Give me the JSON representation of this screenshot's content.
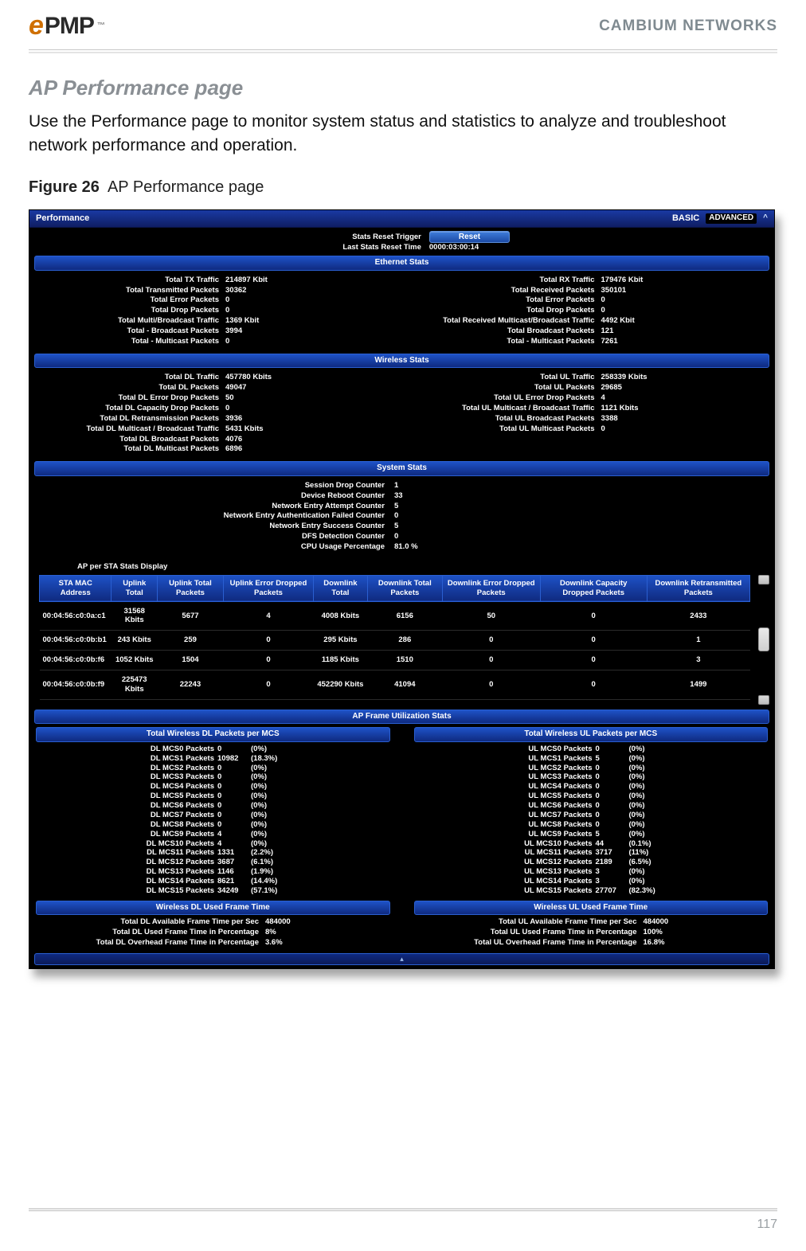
{
  "doc": {
    "logo_text_pmp": "PMP",
    "brand": "CAMBIUM NETWORKS",
    "section_title": "AP Performance page",
    "lead": "Use the Performance page to monitor system status and statistics to analyze and troubleshoot network performance and operation.",
    "figure_label_bold": "Figure 26",
    "figure_label_rest": "AP Performance page",
    "page_number": "117"
  },
  "ui": {
    "title": "Performance",
    "basic": "BASIC",
    "advanced": "ADVANCED",
    "chevron": "^",
    "stats_reset_trigger_label": "Stats Reset Trigger",
    "reset_button": "Reset",
    "last_reset_label": "Last Stats Reset Time",
    "last_reset_value": "0000:03:00:14",
    "ethernet_header": "Ethernet Stats",
    "ethernet_left": [
      {
        "k": "Total TX Traffic",
        "v": "214897 Kbit"
      },
      {
        "k": "Total Transmitted Packets",
        "v": "30362"
      },
      {
        "k": "Total Error Packets",
        "v": "0"
      },
      {
        "k": "Total Drop Packets",
        "v": "0"
      },
      {
        "k": "Total Multi/Broadcast Traffic",
        "v": "1369 Kbit"
      },
      {
        "k": "Total - Broadcast Packets",
        "v": "3994"
      },
      {
        "k": "Total - Multicast Packets",
        "v": "0"
      }
    ],
    "ethernet_right": [
      {
        "k": "Total RX Traffic",
        "v": "179476 Kbit"
      },
      {
        "k": "Total Received Packets",
        "v": "350101"
      },
      {
        "k": "Total Error Packets",
        "v": "0"
      },
      {
        "k": "Total Drop Packets",
        "v": "0"
      },
      {
        "k": "Total Received Multicast/Broadcast Traffic",
        "v": "4492 Kbit"
      },
      {
        "k": "Total Broadcast Packets",
        "v": "121"
      },
      {
        "k": "Total - Multicast Packets",
        "v": "7261"
      }
    ],
    "wireless_header": "Wireless Stats",
    "wireless_left": [
      {
        "k": "Total DL Traffic",
        "v": "457780 Kbits"
      },
      {
        "k": "Total DL Packets",
        "v": "49047"
      },
      {
        "k": "Total DL Error Drop Packets",
        "v": "50"
      },
      {
        "k": "Total DL Capacity Drop Packets",
        "v": "0"
      },
      {
        "k": "Total DL Retransmission Packets",
        "v": "3936"
      },
      {
        "k": "Total DL Multicast / Broadcast Traffic",
        "v": "5431 Kbits"
      },
      {
        "k": "Total DL Broadcast Packets",
        "v": "4076"
      },
      {
        "k": "Total DL Multicast Packets",
        "v": "6896"
      }
    ],
    "wireless_right": [
      {
        "k": "Total UL Traffic",
        "v": "258339 Kbits"
      },
      {
        "k": "Total UL Packets",
        "v": "29685"
      },
      {
        "k": "Total UL Error Drop Packets",
        "v": "4"
      },
      {
        "k": "Total UL Multicast / Broadcast Traffic",
        "v": "1121 Kbits"
      },
      {
        "k": "Total UL Broadcast Packets",
        "v": "3388"
      },
      {
        "k": "Total UL Multicast Packets",
        "v": "0"
      }
    ],
    "system_header": "System  Stats",
    "system_stats": [
      {
        "k": "Session Drop Counter",
        "v": "1"
      },
      {
        "k": "Device Reboot Counter",
        "v": "33"
      },
      {
        "k": "Network Entry Attempt Counter",
        "v": "5"
      },
      {
        "k": "Network Entry Authentication Failed Counter",
        "v": "0"
      },
      {
        "k": "Network Entry Success Counter",
        "v": "5"
      },
      {
        "k": "DFS Detection Counter",
        "v": "0"
      },
      {
        "k": "CPU Usage Percentage",
        "v": "81.0 %"
      }
    ],
    "ap_per_sta_label": "AP per STA Stats Display",
    "sta_headers": [
      "STA MAC Address",
      "Uplink Total",
      "Uplink Total Packets",
      "Uplink Error Dropped Packets",
      "Downlink Total",
      "Downlink Total Packets",
      "Downlink Error Dropped Packets",
      "Downlink Capacity Dropped Packets",
      "Downlink Retransmitted Packets"
    ],
    "sta_rows": [
      [
        "00:04:56:c0:0a:c1",
        "31568 Kbits",
        "5677",
        "4",
        "4008 Kbits",
        "6156",
        "50",
        "0",
        "2433"
      ],
      [
        "00:04:56:c0:0b:b1",
        "243 Kbits",
        "259",
        "0",
        "295 Kbits",
        "286",
        "0",
        "0",
        "1"
      ],
      [
        "00:04:56:c0:0b:f6",
        "1052 Kbits",
        "1504",
        "0",
        "1185 Kbits",
        "1510",
        "0",
        "0",
        "3"
      ],
      [
        "00:04:56:c0:0b:f9",
        "225473 Kbits",
        "22243",
        "0",
        "452290 Kbits",
        "41094",
        "0",
        "0",
        "1499"
      ]
    ],
    "ap_frame_util_header": "AP Frame Utilization Stats",
    "dl_mcs_header": "Total Wireless DL Packets per MCS",
    "ul_mcs_header": "Total Wireless UL Packets per MCS",
    "dl_mcs": [
      {
        "k": "DL MCS0 Packets",
        "c": "0",
        "p": "(0%)"
      },
      {
        "k": "DL MCS1 Packets",
        "c": "10982",
        "p": "(18.3%)"
      },
      {
        "k": "DL MCS2 Packets",
        "c": "0",
        "p": "(0%)"
      },
      {
        "k": "DL MCS3 Packets",
        "c": "0",
        "p": "(0%)"
      },
      {
        "k": "DL MCS4 Packets",
        "c": "0",
        "p": "(0%)"
      },
      {
        "k": "DL MCS5 Packets",
        "c": "0",
        "p": "(0%)"
      },
      {
        "k": "DL MCS6 Packets",
        "c": "0",
        "p": "(0%)"
      },
      {
        "k": "DL MCS7 Packets",
        "c": "0",
        "p": "(0%)"
      },
      {
        "k": "DL MCS8 Packets",
        "c": "0",
        "p": "(0%)"
      },
      {
        "k": "DL MCS9 Packets",
        "c": "4",
        "p": "(0%)"
      },
      {
        "k": "DL MCS10 Packets",
        "c": "4",
        "p": "(0%)"
      },
      {
        "k": "DL MCS11 Packets",
        "c": "1331",
        "p": "(2.2%)"
      },
      {
        "k": "DL MCS12 Packets",
        "c": "3687",
        "p": "(6.1%)"
      },
      {
        "k": "DL MCS13 Packets",
        "c": "1146",
        "p": "(1.9%)"
      },
      {
        "k": "DL MCS14 Packets",
        "c": "8621",
        "p": "(14.4%)"
      },
      {
        "k": "DL MCS15 Packets",
        "c": "34249",
        "p": "(57.1%)"
      }
    ],
    "ul_mcs": [
      {
        "k": "UL MCS0 Packets",
        "c": "0",
        "p": "(0%)"
      },
      {
        "k": "UL MCS1 Packets",
        "c": "5",
        "p": "(0%)"
      },
      {
        "k": "UL MCS2 Packets",
        "c": "0",
        "p": "(0%)"
      },
      {
        "k": "UL MCS3 Packets",
        "c": "0",
        "p": "(0%)"
      },
      {
        "k": "UL MCS4 Packets",
        "c": "0",
        "p": "(0%)"
      },
      {
        "k": "UL MCS5 Packets",
        "c": "0",
        "p": "(0%)"
      },
      {
        "k": "UL MCS6 Packets",
        "c": "0",
        "p": "(0%)"
      },
      {
        "k": "UL MCS7 Packets",
        "c": "0",
        "p": "(0%)"
      },
      {
        "k": "UL MCS8 Packets",
        "c": "0",
        "p": "(0%)"
      },
      {
        "k": "UL MCS9 Packets",
        "c": "5",
        "p": "(0%)"
      },
      {
        "k": "UL MCS10 Packets",
        "c": "44",
        "p": "(0.1%)"
      },
      {
        "k": "UL MCS11 Packets",
        "c": "3717",
        "p": "(11%)"
      },
      {
        "k": "UL MCS12 Packets",
        "c": "2189",
        "p": "(6.5%)"
      },
      {
        "k": "UL MCS13 Packets",
        "c": "3",
        "p": "(0%)"
      },
      {
        "k": "UL MCS14 Packets",
        "c": "3",
        "p": "(0%)"
      },
      {
        "k": "UL MCS15 Packets",
        "c": "27707",
        "p": "(82.3%)"
      }
    ],
    "dl_frame_header": "Wireless DL Used Frame Time",
    "ul_frame_header": "Wireless UL Used Frame Time",
    "dl_frame": [
      {
        "k": "Total DL Available Frame Time per Sec",
        "v": "484000"
      },
      {
        "k": "Total DL Used Frame Time in Percentage",
        "v": "8%"
      },
      {
        "k": "Total DL Overhead Frame Time in Percentage",
        "v": "3.6%"
      }
    ],
    "ul_frame": [
      {
        "k": "Total UL Available Frame Time per Sec",
        "v": "484000"
      },
      {
        "k": "Total UL Used Frame Time in Percentage",
        "v": "100%"
      },
      {
        "k": "Total UL Overhead Frame Time in Percentage",
        "v": "16.8%"
      }
    ]
  }
}
